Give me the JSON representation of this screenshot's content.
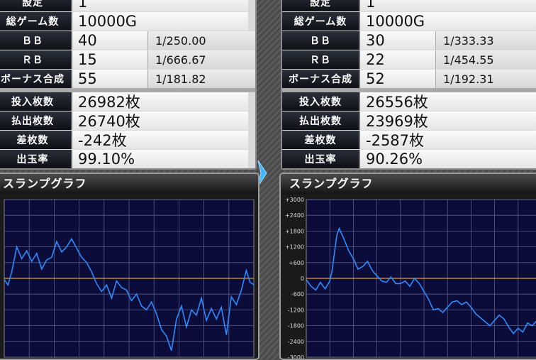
{
  "machines": [
    {
      "top_label": "設定",
      "top_value": "1",
      "stats": {
        "total_games": {
          "label": "総ゲーム数",
          "value": "10000G"
        },
        "bb": {
          "label": "ＢＢ",
          "value": "40",
          "prob": "1/250.00"
        },
        "rb": {
          "label": "ＲＢ",
          "value": "15",
          "prob": "1/666.67"
        },
        "bonus": {
          "label": "ボーナス合成",
          "value": "55",
          "prob": "1/181.82"
        },
        "in": {
          "label": "投入枚数",
          "value": "26982枚"
        },
        "out": {
          "label": "払出枚数",
          "value": "26740枚"
        },
        "diff": {
          "label": "差枚数",
          "value": "-242枚"
        },
        "rate": {
          "label": "出玉率",
          "value": "99.10%"
        }
      },
      "graph": {
        "title": "スランプグラフ",
        "ylim": [
          -3000,
          3000
        ],
        "tick_labels": [],
        "zero_line_color": "#e0a030",
        "line_color": "#2a8cff",
        "series": [
          [
            0,
            -50
          ],
          [
            150,
            -250
          ],
          [
            300,
            250
          ],
          [
            500,
            1200
          ],
          [
            700,
            750
          ],
          [
            900,
            1050
          ],
          [
            1100,
            650
          ],
          [
            1300,
            950
          ],
          [
            1500,
            350
          ],
          [
            1700,
            700
          ],
          [
            1900,
            800
          ],
          [
            2100,
            1400
          ],
          [
            2300,
            1000
          ],
          [
            2500,
            1200
          ],
          [
            2700,
            1500
          ],
          [
            2900,
            1150
          ],
          [
            3100,
            800
          ],
          [
            3300,
            600
          ],
          [
            3500,
            250
          ],
          [
            3700,
            -200
          ],
          [
            3900,
            -500
          ],
          [
            4100,
            -250
          ],
          [
            4300,
            -750
          ],
          [
            4500,
            -100
          ],
          [
            4700,
            -350
          ],
          [
            4900,
            -450
          ],
          [
            5100,
            -850
          ],
          [
            5300,
            -600
          ],
          [
            5500,
            -1050
          ],
          [
            5700,
            -1200
          ],
          [
            5900,
            -900
          ],
          [
            6100,
            -1350
          ],
          [
            6300,
            -1950
          ],
          [
            6500,
            -2200
          ],
          [
            6700,
            -2750
          ],
          [
            6900,
            -1550
          ],
          [
            7100,
            -1050
          ],
          [
            7300,
            -1850
          ],
          [
            7500,
            -1200
          ],
          [
            7700,
            -1400
          ],
          [
            7900,
            -750
          ],
          [
            8100,
            -1600
          ],
          [
            8300,
            -1150
          ],
          [
            8500,
            -1550
          ],
          [
            8700,
            -1100
          ],
          [
            8900,
            -2150
          ],
          [
            9100,
            -700
          ],
          [
            9300,
            -1000
          ],
          [
            9500,
            -450
          ],
          [
            9700,
            300
          ],
          [
            9850,
            -150
          ],
          [
            10000,
            -242
          ]
        ]
      }
    },
    {
      "top_label": "設定",
      "top_value": "1",
      "stats": {
        "total_games": {
          "label": "総ゲーム数",
          "value": "10000G"
        },
        "bb": {
          "label": "ＢＢ",
          "value": "30",
          "prob": "1/333.33"
        },
        "rb": {
          "label": "ＲＢ",
          "value": "22",
          "prob": "1/454.55"
        },
        "bonus": {
          "label": "ボーナス合成",
          "value": "52",
          "prob": "1/192.31"
        },
        "in": {
          "label": "投入枚数",
          "value": "26556枚"
        },
        "out": {
          "label": "払出枚数",
          "value": "23969枚"
        },
        "diff": {
          "label": "差枚数",
          "value": "-2587枚"
        },
        "rate": {
          "label": "出玉率",
          "value": "90.26%"
        }
      },
      "graph": {
        "title": "スランプグラフ",
        "ylim": [
          -3000,
          3000
        ],
        "tick_labels": [
          "+3000",
          "+2400",
          "+1800",
          "+1200",
          "+600",
          "0",
          "-600",
          "-1200",
          "-1800",
          "-2400",
          "-3000"
        ],
        "zero_line_color": "#e0a030",
        "line_color": "#2a8cff",
        "series": [
          [
            0,
            -50
          ],
          [
            200,
            -300
          ],
          [
            400,
            -450
          ],
          [
            600,
            -150
          ],
          [
            800,
            -400
          ],
          [
            1000,
            -100
          ],
          [
            1100,
            300
          ],
          [
            1200,
            1000
          ],
          [
            1300,
            1650
          ],
          [
            1400,
            1900
          ],
          [
            1600,
            1500
          ],
          [
            1800,
            1050
          ],
          [
            2000,
            750
          ],
          [
            2200,
            350
          ],
          [
            2400,
            450
          ],
          [
            2600,
            650
          ],
          [
            2800,
            300
          ],
          [
            3000,
            100
          ],
          [
            3200,
            -100
          ],
          [
            3400,
            -150
          ],
          [
            3600,
            50
          ],
          [
            3800,
            -200
          ],
          [
            4000,
            -200
          ],
          [
            4200,
            -100
          ],
          [
            4400,
            -300
          ],
          [
            4600,
            0
          ],
          [
            4800,
            -200
          ],
          [
            5000,
            -500
          ],
          [
            5200,
            -800
          ],
          [
            5400,
            -1200
          ],
          [
            5600,
            -1150
          ],
          [
            5800,
            -1300
          ],
          [
            6000,
            -1100
          ],
          [
            6200,
            -900
          ],
          [
            6400,
            -850
          ],
          [
            6600,
            -1000
          ],
          [
            6800,
            -900
          ],
          [
            7000,
            -1100
          ],
          [
            7200,
            -1350
          ],
          [
            7400,
            -1500
          ],
          [
            7600,
            -1650
          ],
          [
            7800,
            -1800
          ],
          [
            8000,
            -1600
          ],
          [
            8200,
            -1400
          ],
          [
            8400,
            -1550
          ],
          [
            8600,
            -1850
          ],
          [
            8800,
            -2100
          ],
          [
            9000,
            -1900
          ],
          [
            9200,
            -2050
          ],
          [
            9400,
            -1700
          ],
          [
            9600,
            -1800
          ],
          [
            9800,
            -1600
          ],
          [
            10000,
            -1650
          ]
        ]
      }
    }
  ]
}
